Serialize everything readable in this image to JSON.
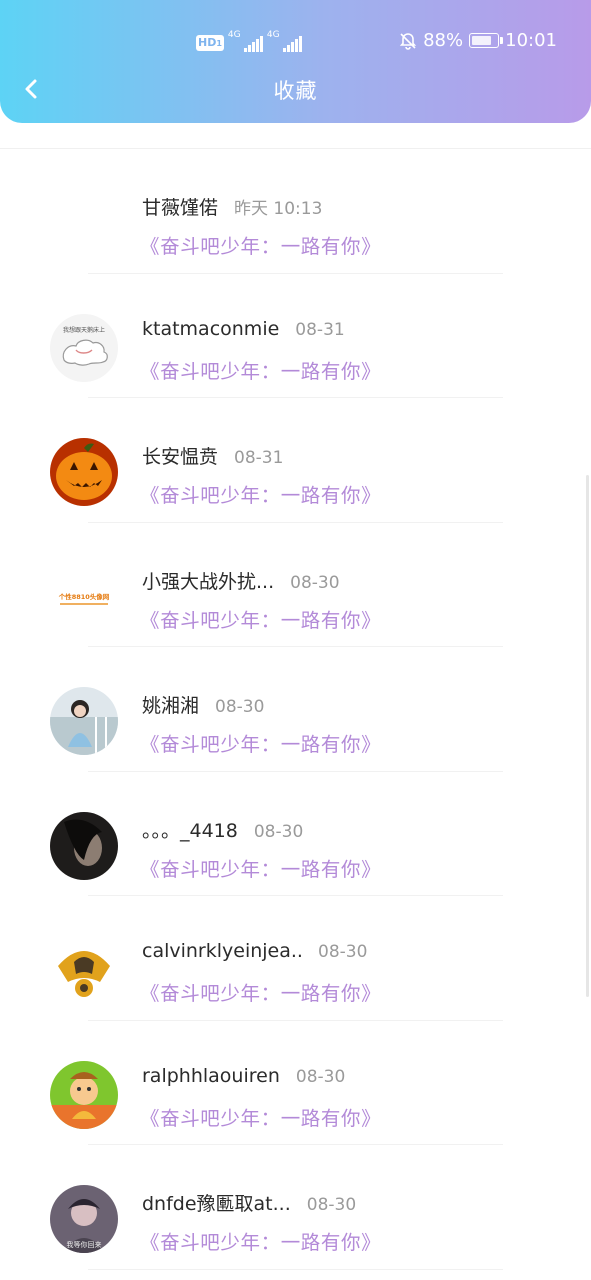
{
  "status_bar": {
    "hd": "HD",
    "sim1": "1",
    "network1": "4G",
    "network2": "4G",
    "battery_pct": "88%",
    "battery_level": 0.88,
    "time": "10:01"
  },
  "header": {
    "title": "收藏",
    "accent_start": "#5dd3f5",
    "accent_end": "#b89be9"
  },
  "favorites": [
    {
      "name": "甘薇馑偌",
      "date": "昨天 10:13",
      "show": "《奋斗吧少年：一路有你》",
      "avatar": "none"
    },
    {
      "name": "ktatmaconmie",
      "date": "08-31",
      "show": "《奋斗吧少年：一路有你》",
      "avatar": "cloud-icon",
      "avatar_caption": "我想跟天鹅床上"
    },
    {
      "name": "长安愠贲",
      "date": "08-31",
      "show": "《奋斗吧少年：一路有你》",
      "avatar": "pumpkin-icon"
    },
    {
      "name": "小强大战外扰...",
      "date": "08-30",
      "show": "《奋斗吧少年：一路有你》",
      "avatar": "text-logo",
      "avatar_caption": "个性8810头像网"
    },
    {
      "name": "姚湘湘",
      "date": "08-30",
      "show": "《奋斗吧少年：一路有你》",
      "avatar": "photo-girl-icon"
    },
    {
      "name": "。。。_4418",
      "date": "08-30",
      "show": "《奋斗吧少年：一路有你》",
      "avatar": "photo-dark-icon"
    },
    {
      "name": "calvinrklyeinjea...",
      "date": "08-30",
      "show": "《奋斗吧少年：一路有你》",
      "avatar": "emblem-icon"
    },
    {
      "name": "ralphhlaouiren",
      "date": "08-30",
      "show": "《奋斗吧少年：一路有你》",
      "avatar": "cartoon-icon"
    },
    {
      "name": "dnfde豫匭取at...",
      "date": "08-30",
      "show": "《奋斗吧少年：一路有你》",
      "avatar": "photo-boy-icon",
      "avatar_caption": "我等你回来"
    }
  ]
}
